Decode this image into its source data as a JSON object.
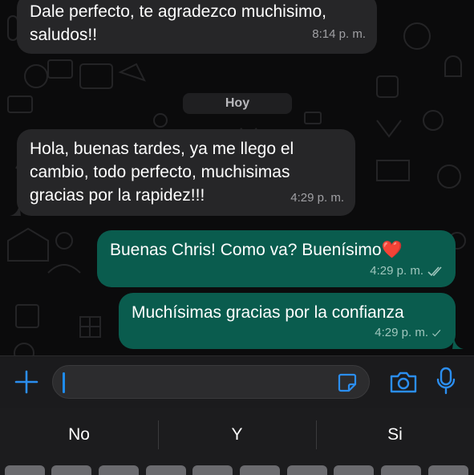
{
  "messages": [
    {
      "direction": "incoming",
      "lines": [
        "Dale perfecto, te agradezco muchisimo,",
        "saludos!!"
      ],
      "time": "8:14 p. m."
    },
    {
      "direction": "incoming",
      "lines": [
        "Hola, buenas tardes, ya me llego el",
        "cambio, todo perfecto, muchisimas",
        "gracias por la rapidez!!!"
      ],
      "time": "4:29 p. m."
    },
    {
      "direction": "outgoing",
      "text": "Buenas  Chris! Como va? Buenísimo",
      "emoji": "❤️",
      "time": "4:29 p. m.",
      "status": "read"
    },
    {
      "direction": "outgoing",
      "text": "Muchísimas gracias por la confianza",
      "time": "4:29 p. m.",
      "status": "sent"
    }
  ],
  "date_divider": "Hoy",
  "composer": {
    "placeholder": "",
    "icons": [
      "plus-icon",
      "sticker-icon",
      "camera-icon",
      "microphone-icon"
    ]
  },
  "keyboard": {
    "suggestions": [
      "No",
      "Y",
      "Si"
    ]
  },
  "colors": {
    "incoming_bubble": "#262628",
    "outgoing_bubble": "#0a5c4e",
    "accent": "#1f8cf0",
    "background": "#0b0b0c"
  }
}
